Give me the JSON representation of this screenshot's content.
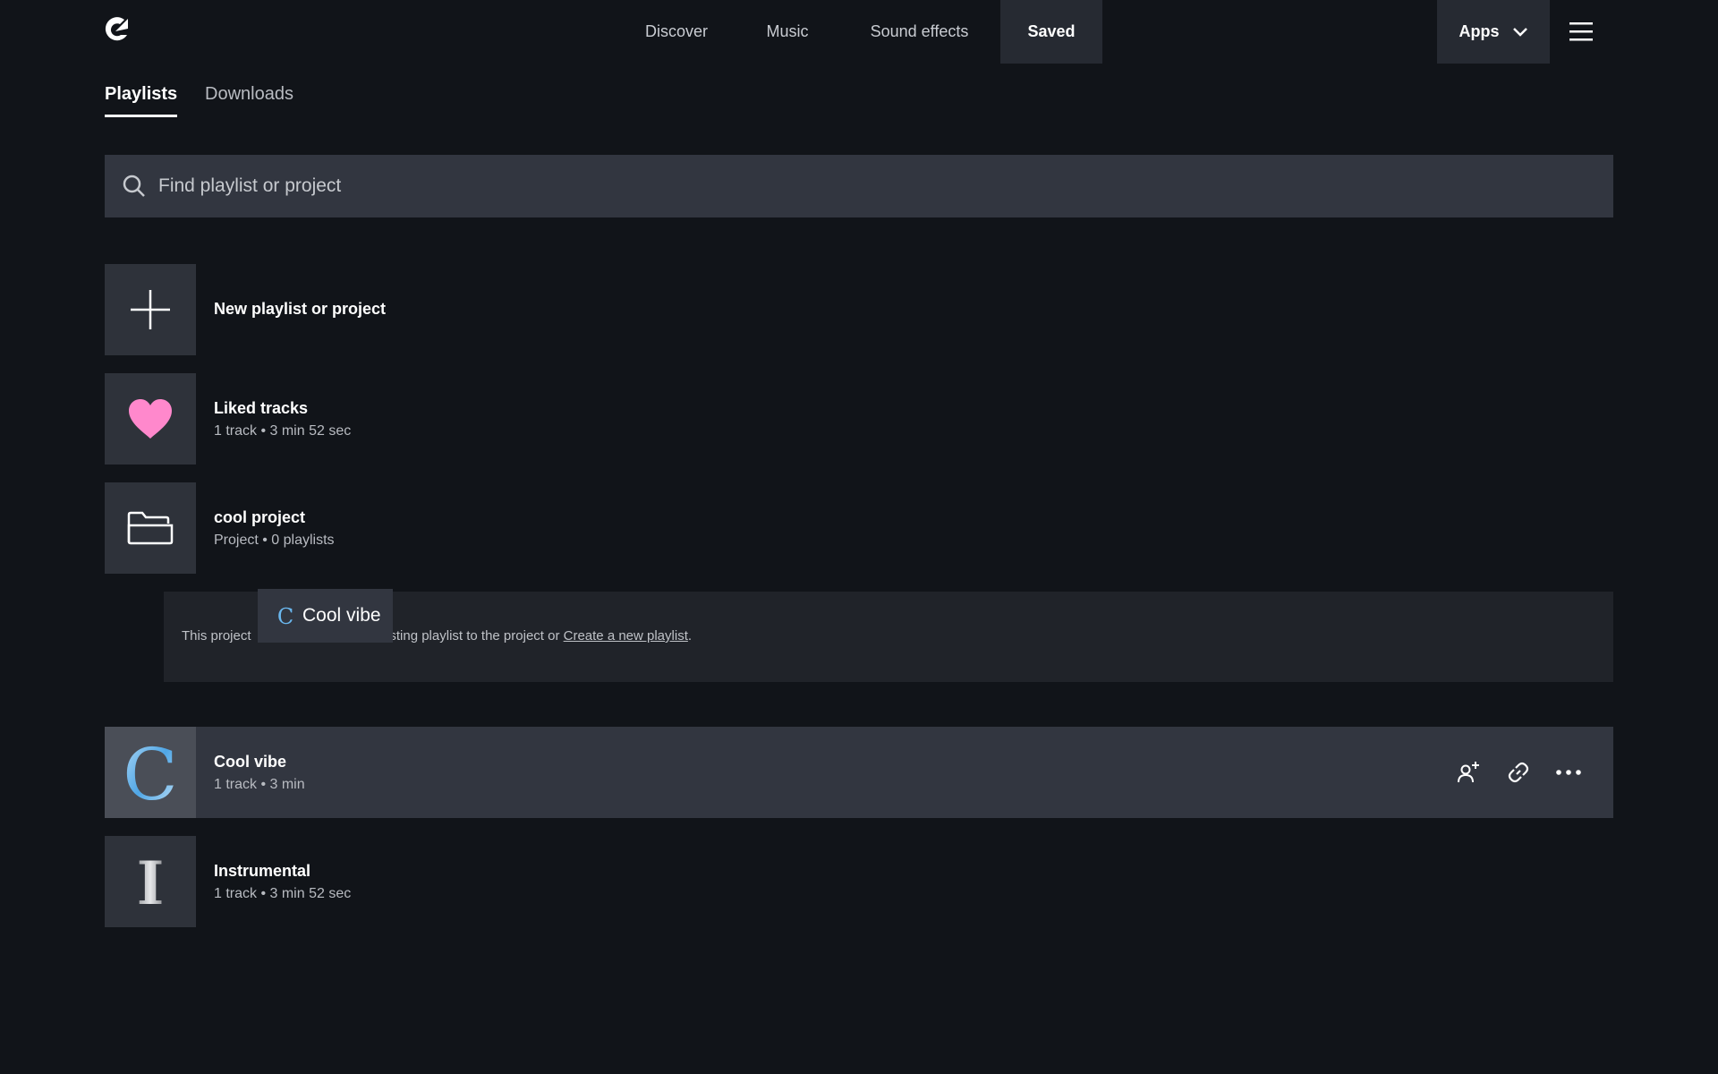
{
  "nav": {
    "items": [
      {
        "label": "Discover"
      },
      {
        "label": "Music"
      },
      {
        "label": "Sound effects"
      },
      {
        "label": "Saved"
      }
    ],
    "active": "Saved",
    "apps_label": "Apps"
  },
  "tabs": [
    {
      "label": "Playlists",
      "active": true
    },
    {
      "label": "Downloads",
      "active": false
    }
  ],
  "search": {
    "placeholder": "Find playlist or project",
    "value": ""
  },
  "list": {
    "new_item": {
      "title": "New playlist or project"
    },
    "liked": {
      "title": "Liked tracks",
      "subtitle": "1 track • 3 min 52 sec",
      "icon": "heart-icon",
      "color": "#ff88cc"
    },
    "project": {
      "title": "cool project",
      "subtitle": "Project • 0 playlists",
      "icon": "folder-icon",
      "empty_text_a": "This project",
      "empty_text_b": "xisting playlist to the project or ",
      "empty_link": "Create a new playlist",
      "empty_text_end": "."
    },
    "drag_ghost": {
      "letter": "C",
      "label": "Cool vibe"
    },
    "cool_vibe": {
      "letter": "C",
      "title": "Cool vibe",
      "subtitle": "1 track • 3 min"
    },
    "instrumental": {
      "letter": "I",
      "title": "Instrumental",
      "subtitle": "1 track • 3 min 52 sec"
    }
  },
  "colors": {
    "background": "#111419",
    "surface": "#323640",
    "accent_heart": "#ff88cc",
    "accent_blue": "#6ab7ee"
  }
}
